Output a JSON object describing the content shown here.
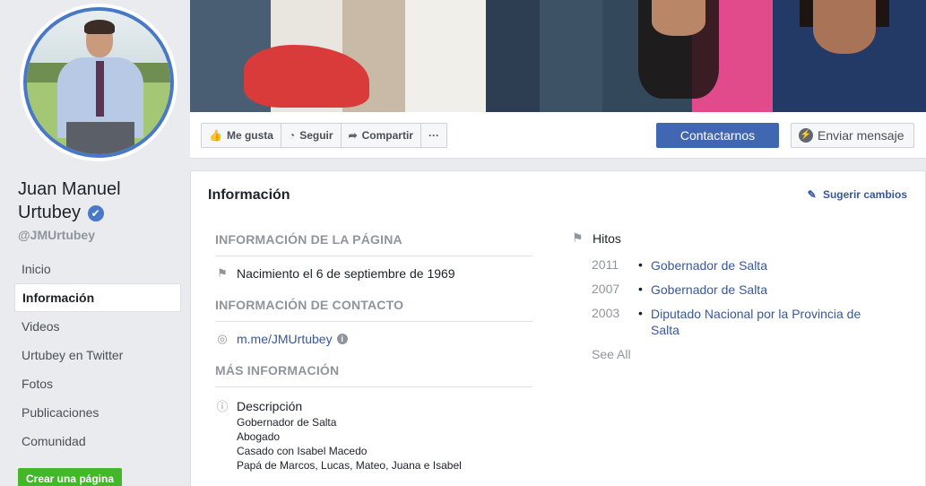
{
  "profile": {
    "name_line1": "Juan Manuel",
    "name_line2": "Urtubey",
    "verified_icon": "✔",
    "handle": "@JMUrtubey"
  },
  "nav": {
    "items": [
      {
        "label": "Inicio",
        "active": false
      },
      {
        "label": "Información",
        "active": true
      },
      {
        "label": "Videos",
        "active": false
      },
      {
        "label": "Urtubey en Twitter",
        "active": false
      },
      {
        "label": "Fotos",
        "active": false
      },
      {
        "label": "Publicaciones",
        "active": false
      },
      {
        "label": "Comunidad",
        "active": false
      }
    ],
    "create_page": "Crear una página"
  },
  "actions": {
    "like": "Me gusta",
    "follow": "Seguir",
    "share": "Compartir",
    "more": "···",
    "contact": "Contactarnos",
    "message": "Enviar mensaje"
  },
  "info": {
    "title": "Información",
    "suggest": "Sugerir cambios",
    "page_info_heading": "INFORMACIÓN DE LA PÁGINA",
    "birth": "Nacimiento el 6 de septiembre de 1969",
    "contact_heading": "INFORMACIÓN DE CONTACTO",
    "messenger_link": "m.me/JMUrtubey",
    "more_heading": "MÁS INFORMACIÓN",
    "description_label": "Descripción",
    "description_lines": [
      "Gobernador de Salta",
      "Abogado",
      "Casado con Isabel Macedo",
      "Papá de Marcos, Lucas, Mateo, Juana e Isabel"
    ]
  },
  "milestones": {
    "label": "Hitos",
    "items": [
      {
        "year": "2011",
        "text": "Gobernador de Salta"
      },
      {
        "year": "2007",
        "text": "Gobernador de Salta"
      },
      {
        "year": "2003",
        "text": "Diputado Nacional por la Provincia de Salta"
      }
    ],
    "see_all": "See All"
  },
  "colors": {
    "link": "#385898",
    "primary_button": "#4267b2",
    "create_button": "#42b72a",
    "avatar_ring": "#4a78c9"
  }
}
